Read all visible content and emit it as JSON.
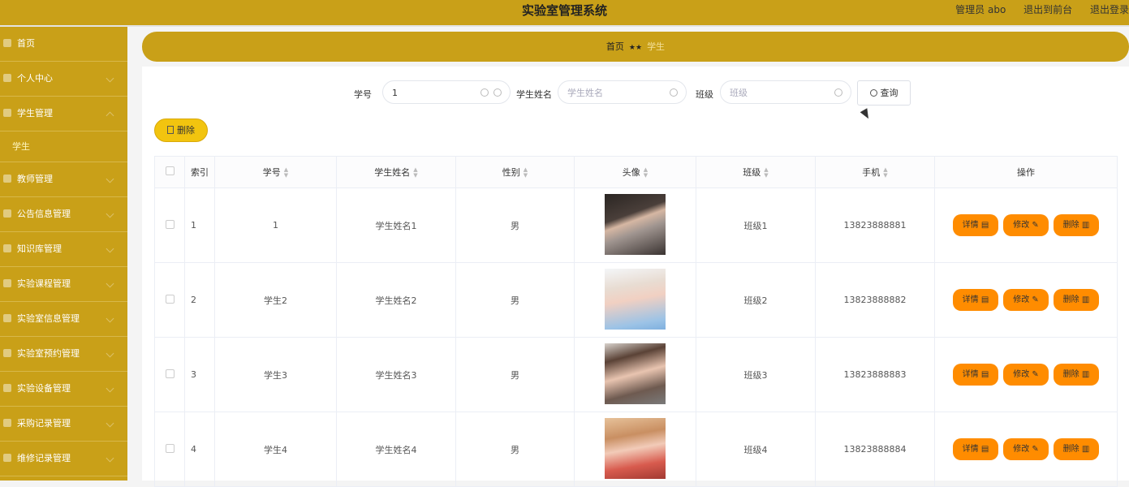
{
  "header": {
    "title": "实验室管理系统",
    "user_label": "管理员 abo",
    "frontend_link": "退出到前台",
    "logout_link": "退出登录"
  },
  "sidebar": {
    "items": [
      {
        "label": "首页"
      },
      {
        "label": "个人中心"
      },
      {
        "label": "学生管理"
      },
      {
        "label": "学生"
      },
      {
        "label": "教师管理"
      },
      {
        "label": "公告信息管理"
      },
      {
        "label": "知识库管理"
      },
      {
        "label": "实验课程管理"
      },
      {
        "label": "实验室信息管理"
      },
      {
        "label": "实验室预约管理"
      },
      {
        "label": "实验设备管理"
      },
      {
        "label": "采购记录管理"
      },
      {
        "label": "维修记录管理"
      }
    ]
  },
  "breadcrumb": {
    "home": "首页",
    "separator": "★★",
    "current": "学生"
  },
  "search": {
    "student_no_label": "学号",
    "student_no_value": "1",
    "student_name_label": "学生姓名",
    "student_name_placeholder": "学生姓名",
    "class_label": "班级",
    "class_placeholder": "班级",
    "query_button": "查询"
  },
  "actions": {
    "delete_button": "删除"
  },
  "table": {
    "headers": {
      "index": "索引",
      "student_no": "学号",
      "student_name": "学生姓名",
      "gender": "性别",
      "avatar": "头像",
      "class": "班级",
      "phone": "手机",
      "ops": "操作"
    },
    "rows": [
      {
        "index": "1",
        "student_no": "1",
        "student_name": "学生姓名1",
        "gender": "男",
        "class": "班级1",
        "phone": "13823888881"
      },
      {
        "index": "2",
        "student_no": "学生2",
        "student_name": "学生姓名2",
        "gender": "男",
        "class": "班级2",
        "phone": "13823888882"
      },
      {
        "index": "3",
        "student_no": "学生3",
        "student_name": "学生姓名3",
        "gender": "男",
        "class": "班级3",
        "phone": "13823888883"
      },
      {
        "index": "4",
        "student_no": "学生4",
        "student_name": "学生姓名4",
        "gender": "男",
        "class": "班级4",
        "phone": "13823888884"
      }
    ],
    "row_buttons": {
      "detail": "详情",
      "edit": "修改",
      "delete": "删除"
    }
  },
  "colors": {
    "primary": "#c9a018",
    "button_orange": "#ff8c00",
    "delete_yellow": "#f2c40f"
  }
}
